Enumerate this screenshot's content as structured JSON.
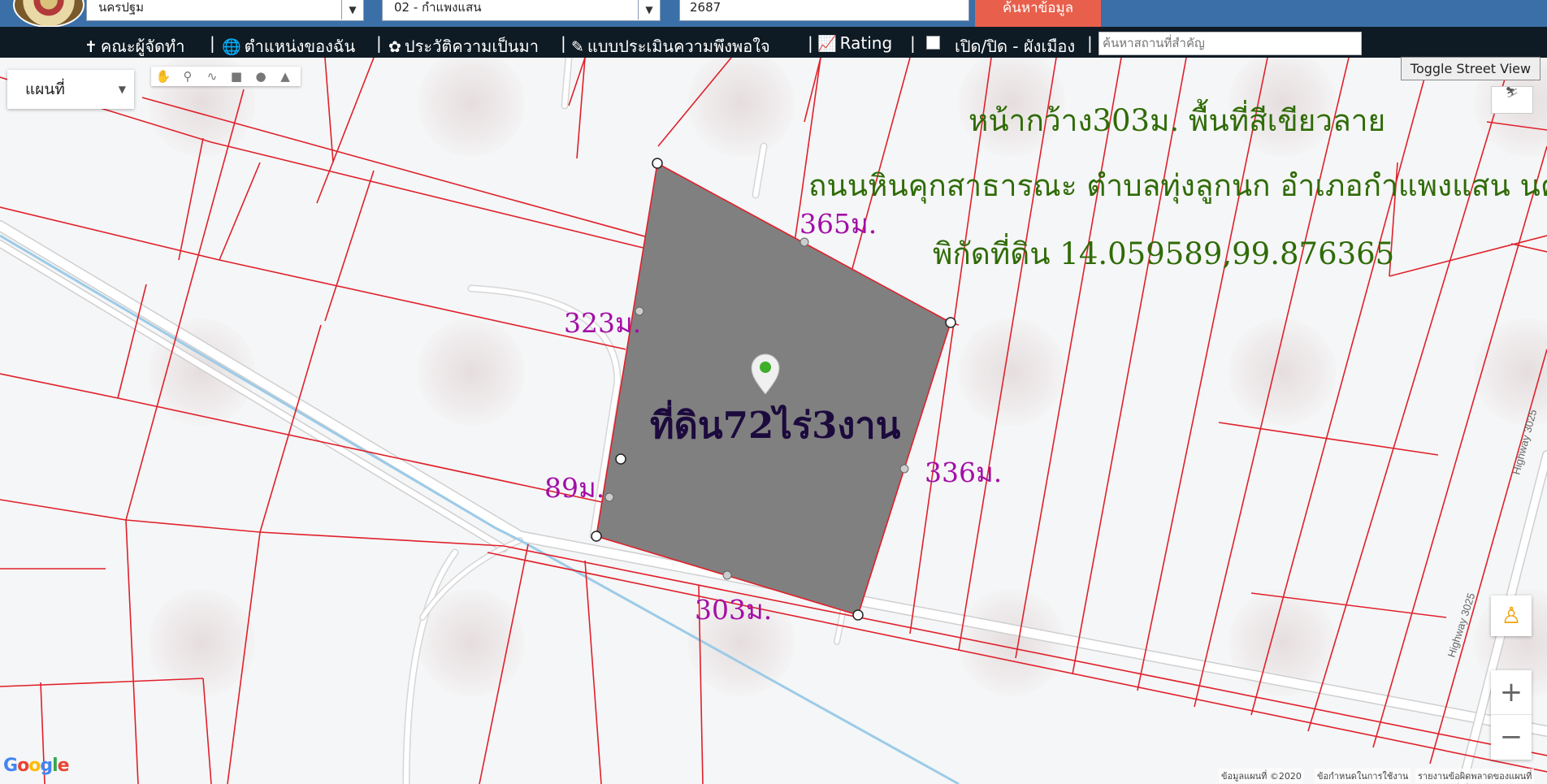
{
  "topbar": {
    "province_select": "นครปฐม",
    "district_select": "02 - กำแพงแสน",
    "parcel_input": "2687",
    "search_button": "ค้นหาข้อมูล"
  },
  "nav": {
    "items": [
      {
        "icon": "palm-icon",
        "label": "คณะผู้จัดทำ"
      },
      {
        "icon": "globe-icon",
        "label": "ตำแหน่งของฉัน"
      },
      {
        "icon": "history-icon",
        "label": "ประวัติความเป็นมา"
      },
      {
        "icon": "survey-icon",
        "label": "แบบประเมินความพึงพอใจ"
      },
      {
        "icon": "chart-icon",
        "label": "Rating"
      }
    ],
    "toggle_label": "เปิด/ปิด - ผังเมือง",
    "search_placeholder": "ค้นหาสถานที่สำคัญ"
  },
  "map": {
    "map_type": "แผนที่",
    "street_view_button": "Toggle Street View",
    "zoom_in": "+",
    "zoom_out": "−",
    "google_logo": "Google",
    "attribution": [
      "ข้อมูลแผนที่ ©2020",
      "ข้อกำหนดในการใช้งาน",
      "รายงานข้อผิดพลาดของแผนที่"
    ],
    "road_label": "Highway 3025",
    "annotations": {
      "line1": "หน้ากว้าง303ม. พื้นที่สีเขียวลาย",
      "line2": "ถนนหินคุกสาธารณะ ตำบลทุ่งลูกนก อำเภอกำแพงแสน นครปฐม",
      "line3": "พิกัดที่ดิน 14.059589,99.876365",
      "title": "ที่ดิน72ไร่3งาน",
      "side_top": "365ม.",
      "side_left": "323ม.",
      "side_right": "336ม.",
      "side_small": "89ม.",
      "side_bottom": "303ม."
    },
    "colors": {
      "parcel_line": "#e0202a",
      "parcel_fill": "#808080",
      "canal": "#9ccbe8",
      "annotation_green": "#2f6b06",
      "annotation_magenta": "#a30fa6"
    }
  }
}
